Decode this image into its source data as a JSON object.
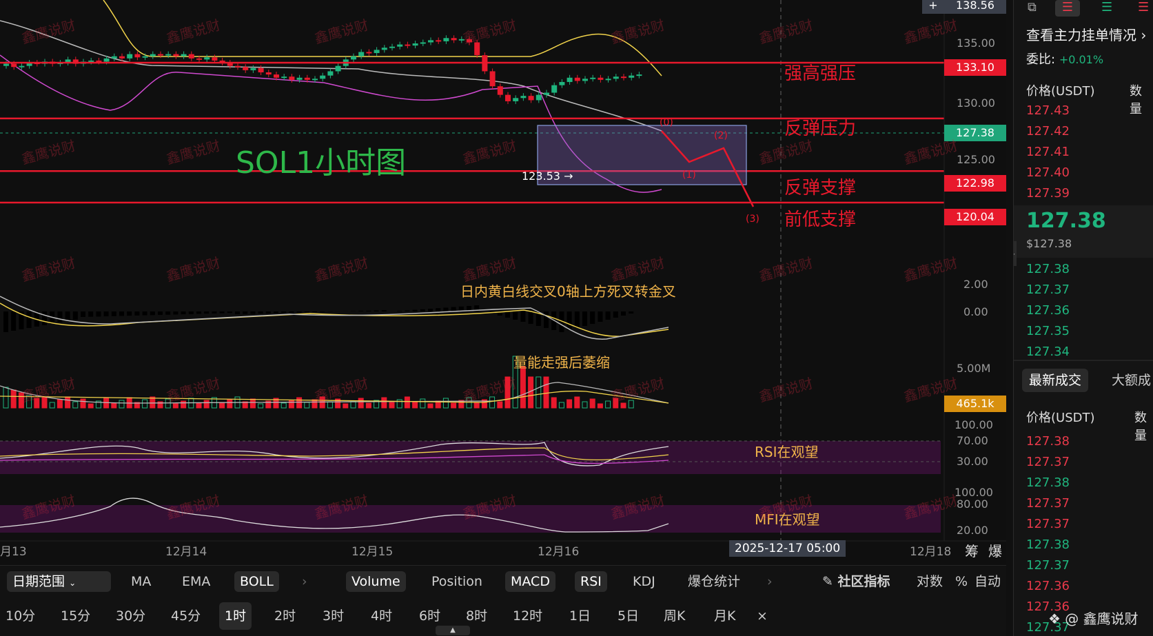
{
  "chart": {
    "title": "SOL1小时图",
    "price_axis": [
      "138.56",
      "135.00",
      "130.00",
      "125.00"
    ],
    "levels": [
      {
        "price": "133.10",
        "label": "强高强压"
      },
      {
        "price": "127.38",
        "label": "反弹压力"
      },
      {
        "price": "122.98",
        "label": "反弹支撑"
      },
      {
        "price": "120.04",
        "label": "前低支撑"
      }
    ],
    "low_marker": "123.53 →",
    "wave_labels": [
      "(0)",
      "(1)",
      "(2)",
      "(3)"
    ],
    "macd_note": "日内黄白线交叉0轴上方死叉转金叉",
    "macd_axis": [
      "2.00",
      "0.00"
    ],
    "volume_note": "量能走强后萎缩",
    "volume_axis": [
      "5.00M"
    ],
    "volume_last": "465.1k",
    "rsi_note": "RSI在观望",
    "rsi_axis": [
      "100.00",
      "70.00",
      "30.00"
    ],
    "mfi_note": "MFI在观望",
    "mfi_axis": [
      "100.00",
      "80.00",
      "20.00"
    ],
    "time_axis": [
      "月13",
      "12月14",
      "12月15",
      "12月16",
      "2025-12-17 05:00",
      "12月18"
    ],
    "time_icons": [
      "筹",
      "爆"
    ],
    "watermark": "鑫鹰说财",
    "colors": {
      "red": "#e8192c",
      "green": "#1fb57e",
      "yellow": "#f2d44b",
      "orange": "#f0b44a"
    }
  },
  "toolbar": {
    "date_range": "日期范围",
    "indicators": [
      "MA",
      "EMA",
      "BOLL",
      "Volume",
      "Position",
      "MACD",
      "RSI",
      "KDJ",
      "爆仓统计"
    ],
    "community": "社区指标",
    "options": [
      "对数",
      "%",
      "自动"
    ]
  },
  "timeframes": [
    "10分",
    "15分",
    "30分",
    "45分",
    "1时",
    "2时",
    "3时",
    "4时",
    "6时",
    "8时",
    "12时",
    "1日",
    "5日",
    "周K",
    "月K"
  ],
  "side": {
    "title": "查看主力挂单情况",
    "ratio_label": "委比:",
    "ratio_value": "+0.01%",
    "col_price": "价格(USDT)",
    "col_qty": "数量",
    "asks": [
      "127.43",
      "127.42",
      "127.41",
      "127.40",
      "127.39"
    ],
    "last_price": "127.38",
    "last_price_usd": "$127.38",
    "bids": [
      "127.38",
      "127.37",
      "127.36",
      "127.35",
      "127.34"
    ],
    "tab_latest": "最新成交",
    "tab_large": "大额成",
    "col_price2": "价格(USDT)",
    "col_qty2": "数量",
    "trades": [
      {
        "p": "127.38",
        "c": "red"
      },
      {
        "p": "127.37",
        "c": "red"
      },
      {
        "p": "127.38",
        "c": "green"
      },
      {
        "p": "127.37",
        "c": "red"
      },
      {
        "p": "127.37",
        "c": "red"
      },
      {
        "p": "127.38",
        "c": "green"
      },
      {
        "p": "127.37",
        "c": "green"
      },
      {
        "p": "127.36",
        "c": "red"
      },
      {
        "p": "127.36",
        "c": "red"
      },
      {
        "p": "127.37",
        "c": "green"
      }
    ],
    "footer": "@ 鑫鹰说财"
  }
}
